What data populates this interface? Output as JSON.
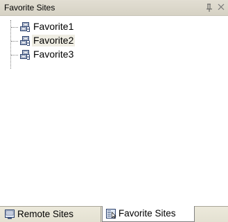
{
  "panel": {
    "title": "Favorite Sites",
    "pin_icon": "pin-icon",
    "close_icon": "close-icon"
  },
  "tree": {
    "node_icon": "server-group-icon",
    "items": [
      {
        "label": "Favorite1",
        "selected": false
      },
      {
        "label": "Favorite2",
        "selected": true
      },
      {
        "label": "Favorite3",
        "selected": false
      }
    ]
  },
  "tabs": [
    {
      "label": "Remote Sites",
      "icon": "remote-sites-icon",
      "active": false
    },
    {
      "label": "Favorite Sites",
      "icon": "favorite-sites-icon",
      "active": true
    }
  ],
  "colors": {
    "titlebar": "#d6d2c4",
    "selection": "#efede3",
    "tabbar": "#e4e1d2"
  }
}
